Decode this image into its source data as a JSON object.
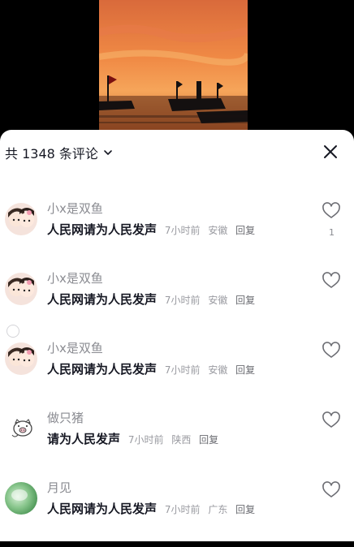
{
  "header": {
    "title": "共 1348 条评论"
  },
  "comments": [
    {
      "username": "小x是双鱼",
      "text": "人民网请为人民发声",
      "time": "7小时前",
      "location": "安徽",
      "reply": "回复",
      "likes": "1"
    },
    {
      "username": "小x是双鱼",
      "text": "人民网请为人民发声",
      "time": "7小时前",
      "location": "安徽",
      "reply": "回复",
      "likes": ""
    },
    {
      "username": "小x是双鱼",
      "text": "人民网请为人民发声",
      "time": "7小时前",
      "location": "安徽",
      "reply": "回复",
      "likes": ""
    },
    {
      "username": "做只猪",
      "text": "请为人民发声",
      "time": "7小时前",
      "location": "陕西",
      "reply": "回复",
      "likes": ""
    },
    {
      "username": "月见",
      "text": "人民网请为人民发声",
      "time": "7小时前",
      "location": "广东",
      "reply": "回复",
      "likes": ""
    }
  ]
}
